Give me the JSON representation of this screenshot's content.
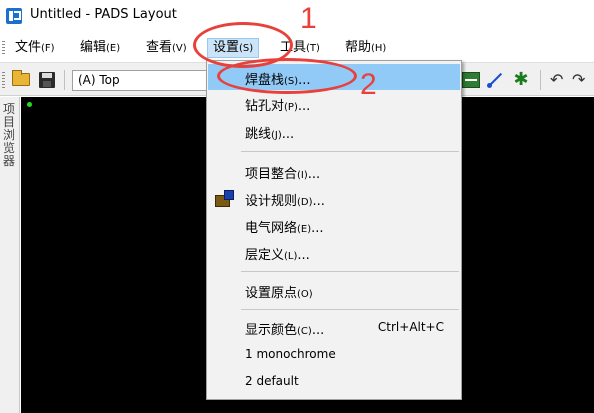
{
  "window": {
    "title": "Untitled - PADS Layout"
  },
  "menubar": {
    "items": [
      {
        "label": "文件",
        "key": "(F)"
      },
      {
        "label": "编辑",
        "key": "(E)"
      },
      {
        "label": "查看",
        "key": "(V)"
      },
      {
        "label": "设置",
        "key": "(S)"
      },
      {
        "label": "工具",
        "key": "(T)"
      },
      {
        "label": "帮助",
        "key": "(H)"
      }
    ]
  },
  "toolbar": {
    "layer_value": "(A) Top"
  },
  "side_panel": {
    "label": "项目浏览器"
  },
  "dropdown": {
    "items": [
      {
        "label": "焊盘栈",
        "key": "(S)",
        "suffix": "..."
      },
      {
        "label": "钻孔对",
        "key": "(P)",
        "suffix": "..."
      },
      {
        "label": "跳线",
        "key": "(J)",
        "suffix": "..."
      },
      {
        "label": "项目整合",
        "key": "(I)",
        "suffix": "..."
      },
      {
        "label": "设计规则",
        "key": "(D)",
        "suffix": "..."
      },
      {
        "label": "电气网络",
        "key": "(E)",
        "suffix": "..."
      },
      {
        "label": "层定义",
        "key": "(L)",
        "suffix": "..."
      },
      {
        "label": "设置原点",
        "key": "(O)",
        "suffix": ""
      },
      {
        "label": "显示颜色",
        "key": "(C)",
        "suffix": "...",
        "shortcut": "Ctrl+Alt+C"
      },
      {
        "label": "1 monochrome"
      },
      {
        "label": "2 default"
      }
    ]
  },
  "annotations": {
    "first": "1",
    "second": "2"
  },
  "colors": {
    "annotation": "#e8403a",
    "canvas": "#000000",
    "hover": "#91c9f7",
    "origin": "#22dd22"
  }
}
